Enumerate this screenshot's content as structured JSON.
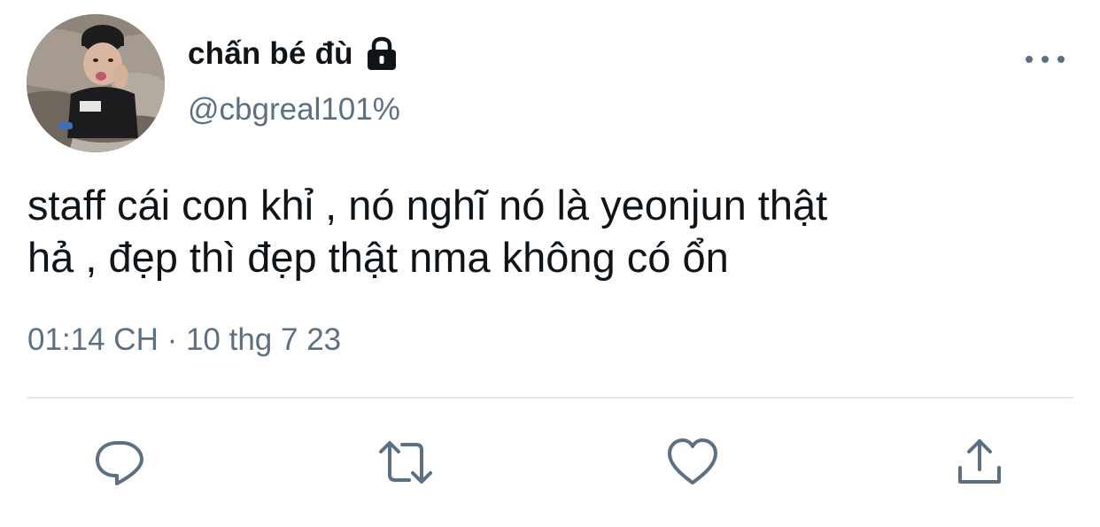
{
  "tweet": {
    "display_name": "chấn bé đù",
    "protected_icon": "lock-icon",
    "handle": "@cbgreal101%",
    "text": "staff cái con khỉ , nó nghĩ nó là yeonjun thật\nhả , đẹp thì đẹp thật nma không có ổn",
    "timestamp": "01:14 CH · 10 thg 7 23"
  },
  "actions": [
    {
      "icon": "reply-icon"
    },
    {
      "icon": "retweet-icon"
    },
    {
      "icon": "like-icon"
    },
    {
      "icon": "share-icon"
    }
  ],
  "colors": {
    "text": "#0f1419",
    "secondary": "#5b7083",
    "divider": "#e1e8ed",
    "background": "#ffffff"
  }
}
